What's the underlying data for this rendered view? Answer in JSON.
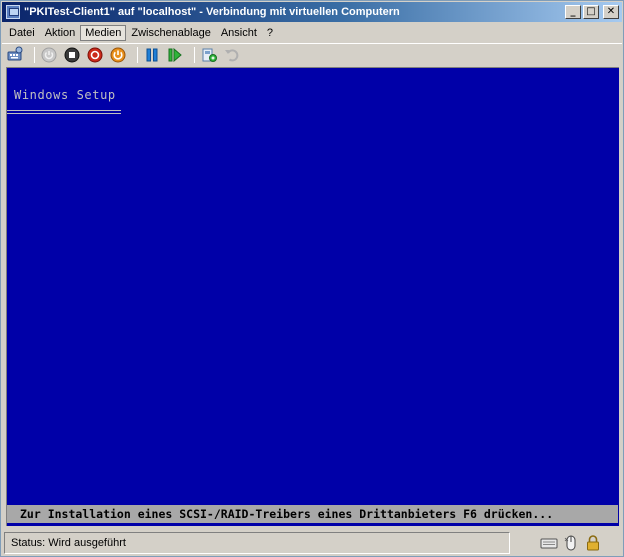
{
  "window": {
    "title": "\"PKITest-Client1\" auf \"localhost\" - Verbindung mit virtuellen Computern",
    "controls": {
      "minimize": "_",
      "maximize": "□",
      "close": "✕"
    }
  },
  "menubar": {
    "items": [
      {
        "label": "Datei",
        "active": false
      },
      {
        "label": "Aktion",
        "active": false
      },
      {
        "label": "Medien",
        "active": true
      },
      {
        "label": "Zwischenablage",
        "active": false
      },
      {
        "label": "Ansicht",
        "active": false
      },
      {
        "label": "?",
        "active": false
      }
    ]
  },
  "toolbar": {
    "buttons": [
      {
        "icon": "ctrl-alt-del-icon",
        "enabled": true
      },
      {
        "icon": "start-icon",
        "enabled": false
      },
      {
        "icon": "turn-off-icon",
        "enabled": true
      },
      {
        "icon": "shut-down-icon",
        "enabled": true
      },
      {
        "icon": "power-icon",
        "enabled": true
      },
      {
        "icon": "pause-icon",
        "enabled": true
      },
      {
        "icon": "resume-icon",
        "enabled": true
      },
      {
        "icon": "snapshot-icon",
        "enabled": true
      },
      {
        "icon": "revert-icon",
        "enabled": false
      }
    ]
  },
  "screen": {
    "title": "Windows Setup",
    "hint": "Zur Installation eines SCSI-/RAID-Treibers eines Drittanbieters F6 drücken...",
    "background": "#0000a8",
    "hint_background": "#a8a8a8"
  },
  "statusbar": {
    "text": "Status: Wird ausgeführt",
    "icons": [
      "keyboard-icon",
      "mouse-icon",
      "lock-icon"
    ]
  }
}
